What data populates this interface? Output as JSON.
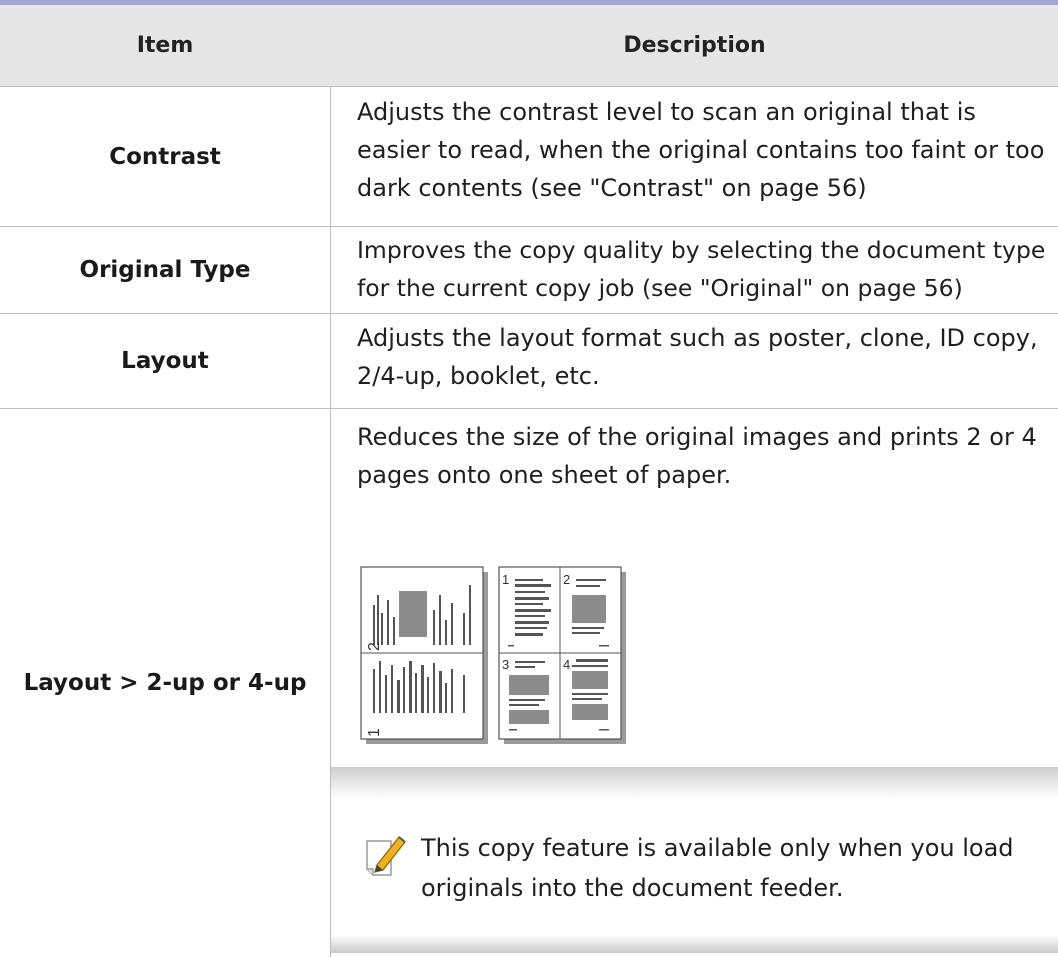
{
  "table": {
    "header": {
      "item": "Item",
      "description": "Description"
    },
    "rows": [
      {
        "item": "Contrast",
        "description": "Adjusts the contrast level to scan an original that is easier to read, when the original contains too faint or too dark contents (see \"Contrast\" on page 56)"
      },
      {
        "item": "Original Type",
        "description": "Improves the copy quality by selecting the document type for the current copy job (see \"Original\" on page 56)"
      },
      {
        "item": "Layout",
        "description": "Adjusts the layout format such as poster, clone, ID copy, 2/4-up, booklet, etc."
      },
      {
        "item": "Layout > 2-up or 4-up",
        "description": "Reduces the size of the original images and prints 2 or 4 pages onto one sheet of paper.",
        "illustration": {
          "two_up_labels": [
            "2",
            "1"
          ],
          "four_up_labels": [
            "1",
            "2",
            "3",
            "4"
          ]
        },
        "note": {
          "icon": "pencil-note-icon",
          "text": "This copy feature is available only when you load originals into the document feeder."
        }
      }
    ]
  },
  "colors": {
    "top_rule": "#a4a8cf",
    "header_bg": "#e6e6e6",
    "grid_line": "#bdbdbd",
    "note_icon_accent": "#f2b21b"
  }
}
